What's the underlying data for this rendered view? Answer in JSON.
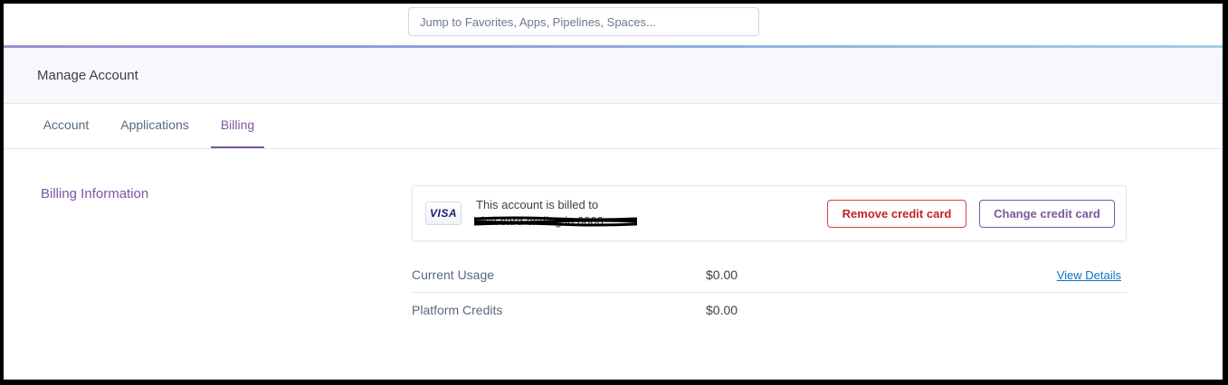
{
  "search": {
    "placeholder": "Jump to Favorites, Apps, Pipelines, Spaces..."
  },
  "header": {
    "title": "Manage Account"
  },
  "tabs": [
    {
      "label": "Account",
      "active": false
    },
    {
      "label": "Applications",
      "active": false
    },
    {
      "label": "Billing",
      "active": true
    }
  ],
  "billing": {
    "section_label": "Billing Information",
    "card": {
      "brand": "VISA",
      "billed_to_label": "This account is billed to",
      "card_info_redacted": "Visa card ending in 0000",
      "remove_label": "Remove credit card",
      "change_label": "Change credit card"
    },
    "rows": [
      {
        "label": "Current Usage",
        "value": "$0.00",
        "link": "View Details"
      },
      {
        "label": "Platform Credits",
        "value": "$0.00"
      }
    ]
  },
  "colors": {
    "accent": "#79589f",
    "danger": "#c72121",
    "link": "#0d74c4",
    "text": "#596981"
  }
}
